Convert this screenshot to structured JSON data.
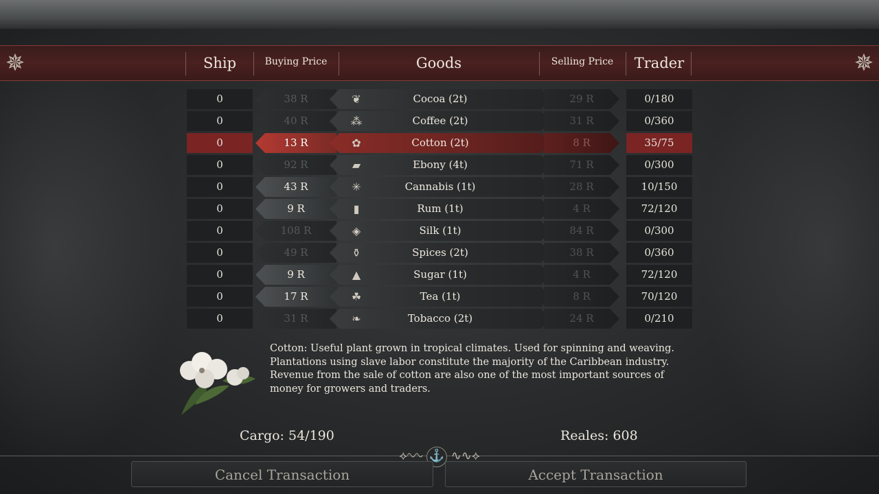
{
  "columns": {
    "ship": "Ship",
    "buying_price": "Buying Price",
    "goods": "Goods",
    "selling_price": "Selling Price",
    "trader": "Trader"
  },
  "rows": [
    {
      "ship": "0",
      "buy": "38 R",
      "icon": "cocoa-bean-icon",
      "glyph": "❦",
      "name": "Cocoa (2t)",
      "sell": "29 R",
      "trader": "0/180",
      "buy_state": "dim"
    },
    {
      "ship": "0",
      "buy": "40 R",
      "icon": "coffee-beans-icon",
      "glyph": "⁂",
      "name": "Coffee (2t)",
      "sell": "31 R",
      "trader": "0/360",
      "buy_state": "dim"
    },
    {
      "ship": "0",
      "buy": "13 R",
      "icon": "cotton-flower-icon",
      "glyph": "✿",
      "name": "Cotton (2t)",
      "sell": "8 R",
      "trader": "35/75",
      "buy_state": "lit",
      "selected": true
    },
    {
      "ship": "0",
      "buy": "92 R",
      "icon": "ebony-log-icon",
      "glyph": "▰",
      "name": "Ebony (4t)",
      "sell": "71 R",
      "trader": "0/300",
      "buy_state": "dim"
    },
    {
      "ship": "0",
      "buy": "43 R",
      "icon": "cannabis-leaf-icon",
      "glyph": "✳",
      "name": "Cannabis (1t)",
      "sell": "28 R",
      "trader": "10/150",
      "buy_state": "lit"
    },
    {
      "ship": "0",
      "buy": "9 R",
      "icon": "rum-bottle-icon",
      "glyph": "▮",
      "name": "Rum (1t)",
      "sell": "4 R",
      "trader": "72/120",
      "buy_state": "lit"
    },
    {
      "ship": "0",
      "buy": "108 R",
      "icon": "silk-roll-icon",
      "glyph": "◈",
      "name": "Silk (1t)",
      "sell": "84 R",
      "trader": "0/300",
      "buy_state": "dim"
    },
    {
      "ship": "0",
      "buy": "49 R",
      "icon": "mortar-pestle-icon",
      "glyph": "⚱",
      "name": "Spices (2t)",
      "sell": "38 R",
      "trader": "0/360",
      "buy_state": "dim"
    },
    {
      "ship": "0",
      "buy": "9 R",
      "icon": "sugar-pile-icon",
      "glyph": "▲",
      "name": "Sugar (1t)",
      "sell": "4 R",
      "trader": "72/120",
      "buy_state": "lit"
    },
    {
      "ship": "0",
      "buy": "17 R",
      "icon": "tea-leaves-icon",
      "glyph": "☘",
      "name": "Tea (1t)",
      "sell": "8 R",
      "trader": "70/120",
      "buy_state": "lit"
    },
    {
      "ship": "0",
      "buy": "31 R",
      "icon": "tobacco-leaves-icon",
      "glyph": "❧",
      "name": "Tobacco (2t)",
      "sell": "24 R",
      "trader": "0/210",
      "buy_state": "dim"
    }
  ],
  "description": "Cotton: Useful plant grown in tropical climates. Used for spinning and weaving. Plantations using slave labor constitute the majority of the Caribbean industry. Revenue from the sale of cotton are also one of the most important sources of money for growers and traders.",
  "cargo": "Cargo: 54/190",
  "reales": "Reales: 608",
  "buttons": {
    "cancel": "Cancel Transaction",
    "accept": "Accept Transaction"
  },
  "colors": {
    "selected_row": "#7a2424",
    "header_band": "#4a2020"
  }
}
